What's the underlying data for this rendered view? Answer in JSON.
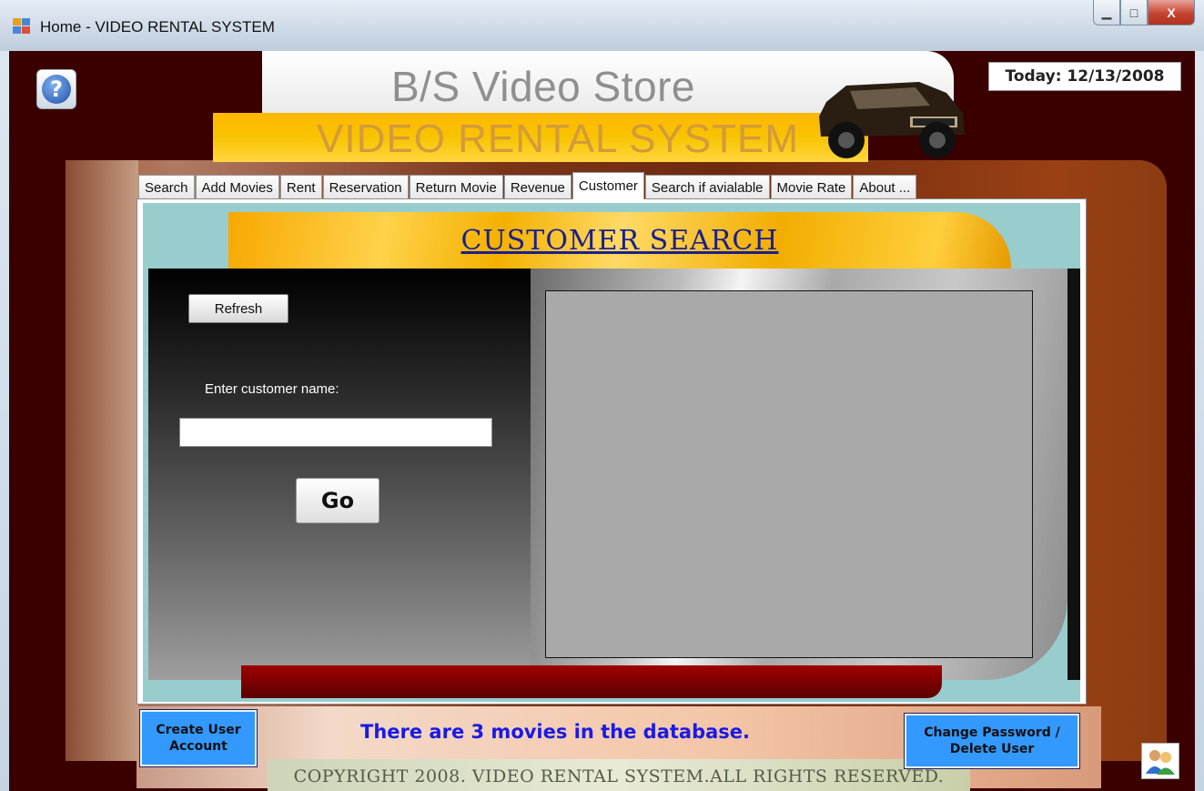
{
  "window": {
    "title": "Home - VIDEO RENTAL SYSTEM",
    "minimize": "▁",
    "maximize": "□",
    "close": "X"
  },
  "header": {
    "help_glyph": "?",
    "store_name": "B/S Video Store",
    "system_name": "VIDEO RENTAL SYSTEM",
    "today": "Today: 12/13/2008"
  },
  "tabs": [
    {
      "label": "Search"
    },
    {
      "label": "Add Movies"
    },
    {
      "label": "Rent"
    },
    {
      "label": "Reservation"
    },
    {
      "label": "Return Movie"
    },
    {
      "label": "Revenue"
    },
    {
      "label": "Customer",
      "active": true
    },
    {
      "label": "Search if avialable"
    },
    {
      "label": "Movie Rate"
    },
    {
      "label": "About ..."
    }
  ],
  "customer_search": {
    "title": "CUSTOMER SEARCH",
    "refresh_label": "Refresh",
    "name_label": "Enter customer name:",
    "name_value": "",
    "go_label": "Go"
  },
  "footer": {
    "create_user": "Create User Account",
    "movies_count": "There are 3 movies in the database.",
    "change_password": "Change Password / Delete User",
    "copyright": "COPYRIGHT 2008. VIDEO RENTAL SYSTEM.ALL RIGHTS  RESERVED."
  },
  "colors": {
    "background_maroon": "#3a0000",
    "accent_yellow": "#f7c400",
    "button_blue": "#3399ff",
    "count_text": "#1a1ae6",
    "title_blue": "#1a1f8e"
  },
  "icons": {
    "app": "app-window-icon",
    "help": "help-icon",
    "truck": "hummer-truck-image",
    "users": "users-icon"
  }
}
